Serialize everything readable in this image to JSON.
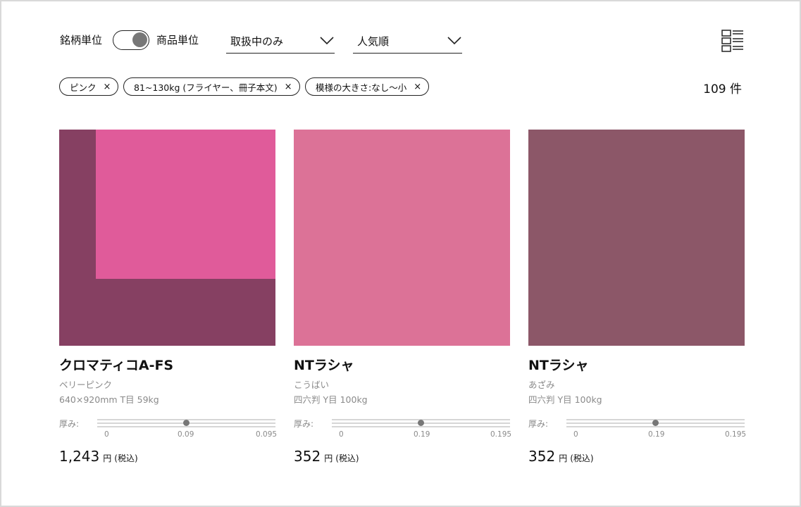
{
  "toolbar": {
    "toggle_left_label": "銘柄単位",
    "toggle_right_label": "商品単位",
    "filter_dropdown": "取扱中のみ",
    "sort_dropdown": "人気順",
    "view_icon": "list-view-icon"
  },
  "filters": {
    "chips": [
      {
        "label": "ピンク",
        "remove": "×"
      },
      {
        "label": "81~130kg (フライヤー、冊子本文)",
        "remove": "×"
      },
      {
        "label": "模様の大きさ:なし〜小",
        "remove": "×"
      }
    ],
    "count": "109 件"
  },
  "products": [
    {
      "name": "クロマティコA-FS",
      "color": "ベリーピンク",
      "spec": "640×920mm T目 59kg",
      "thickness_label": "厚み:",
      "thickness_value": 0.09,
      "thickness_ticks": [
        "0",
        "0.09",
        "0.095"
      ],
      "price": "1,243",
      "currency": "円",
      "tax": "(税込)",
      "swatch_colors": {
        "base": "#8c4467",
        "inner": "#e05b9a"
      }
    },
    {
      "name": "NTラシャ",
      "color": "こうばい",
      "spec": "四六判 Y目 100kg",
      "thickness_label": "厚み:",
      "thickness_value": 0.19,
      "thickness_ticks": [
        "0",
        "0.19",
        "0.195"
      ],
      "price": "352",
      "currency": "円",
      "tax": "(税込)",
      "swatch_colors": {
        "base": "#dc7297"
      }
    },
    {
      "name": "NTラシャ",
      "color": "あざみ",
      "spec": "四六判 Y目 100kg",
      "thickness_label": "厚み:",
      "thickness_value": 0.19,
      "thickness_ticks": [
        "0",
        "0.19",
        "0.195"
      ],
      "price": "352",
      "currency": "円",
      "tax": "(税込)",
      "swatch_colors": {
        "base": "#8c5768"
      }
    }
  ]
}
